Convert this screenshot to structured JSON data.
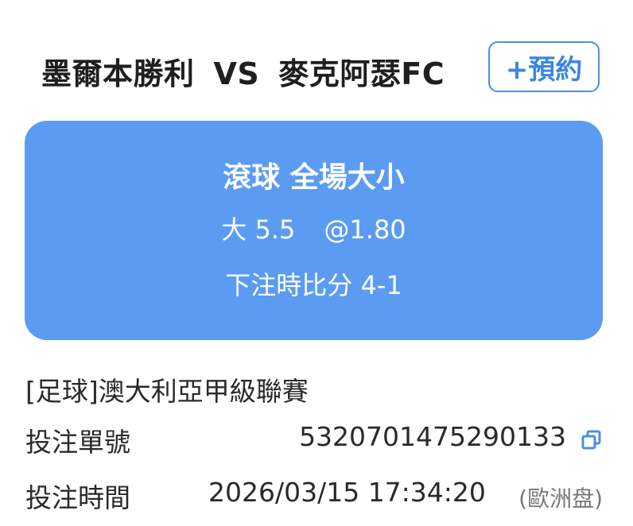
{
  "match": {
    "home_team": "墨爾本勝利",
    "vs": "VS",
    "away_team": "麥克阿瑟FC",
    "reserve_label": "+預約"
  },
  "bet": {
    "type": "滾球 全場大小",
    "selection": "大 5.5",
    "odds": "@1.80",
    "score_at_bet": "下注時比分 4-1"
  },
  "details": {
    "league": "[足球]澳大利亞甲級聯賽",
    "order_label": "投注單號",
    "order_number": "5320701475290133",
    "time_label": "投注時間",
    "bet_time": "2026/03/15 17:34:20",
    "odds_format": "(歐洲盘)"
  },
  "colors": {
    "accent": "#4a90e2",
    "card_background": "#5b9cf2",
    "card_text": "#ffffff"
  },
  "icons": {
    "copy": "copy-icon"
  }
}
